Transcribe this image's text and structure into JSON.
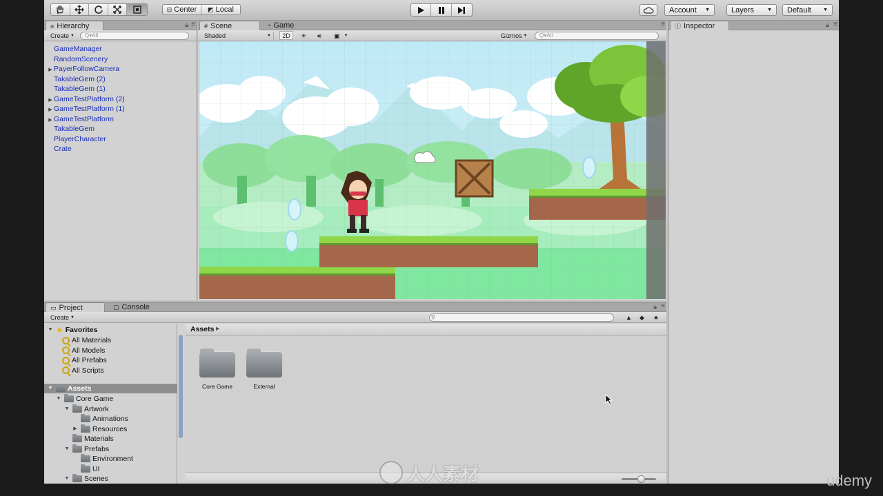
{
  "toolbar": {
    "tools": [
      "hand-tool",
      "move-tool",
      "rotate-tool",
      "scale-tool",
      "rect-tool"
    ],
    "pivot": "Center",
    "space": "Local",
    "account": "Account",
    "layers": "Layers",
    "layout": "Default"
  },
  "hierarchy": {
    "tab": "Hierarchy",
    "create": "Create",
    "search_placeholder": "Q▾All",
    "items": [
      {
        "label": "GameManager",
        "expandable": false
      },
      {
        "label": "RandomScenery",
        "expandable": false
      },
      {
        "label": "PayerFollowCamera",
        "expandable": true
      },
      {
        "label": "TakableGem (2)",
        "expandable": false
      },
      {
        "label": "TakableGem (1)",
        "expandable": false
      },
      {
        "label": "GameTestPlatform (2)",
        "expandable": true
      },
      {
        "label": "GameTestPlatform (1)",
        "expandable": true
      },
      {
        "label": "GameTestPlatform",
        "expandable": true
      },
      {
        "label": "TakableGem",
        "expandable": false
      },
      {
        "label": "PlayerCharacter",
        "expandable": false
      },
      {
        "label": "Crate",
        "expandable": false
      }
    ]
  },
  "scene": {
    "tab_scene": "Scene",
    "tab_game": "Game",
    "shading": "Shaded",
    "mode_2d": "2D",
    "gizmos": "Gizmos",
    "search_placeholder": "Q▾All"
  },
  "inspector": {
    "tab": "Inspector"
  },
  "project": {
    "tab_project": "Project",
    "tab_console": "Console",
    "create": "Create",
    "favorites_label": "Favorites",
    "favorites": [
      "All Materials",
      "All Models",
      "All Prefabs",
      "All Scripts"
    ],
    "assets_label": "Assets",
    "tree": [
      {
        "label": "Core Game",
        "level": 1,
        "arrow": "▼"
      },
      {
        "label": "Artwork",
        "level": 2,
        "arrow": "▼"
      },
      {
        "label": "Animations",
        "level": 3,
        "arrow": ""
      },
      {
        "label": "Resources",
        "level": 3,
        "arrow": "▶"
      },
      {
        "label": "Materials",
        "level": 2,
        "arrow": ""
      },
      {
        "label": "Prefabs",
        "level": 2,
        "arrow": "▼"
      },
      {
        "label": "Environment",
        "level": 3,
        "arrow": ""
      },
      {
        "label": "UI",
        "level": 3,
        "arrow": ""
      },
      {
        "label": "Scenes",
        "level": 2,
        "arrow": "▼"
      }
    ],
    "breadcrumb": "Assets",
    "folders": [
      "Core Game",
      "External"
    ]
  },
  "watermark": {
    "text": "人人素材",
    "brand": "udemy"
  },
  "colors": {
    "hierarchy_text": "#1a2dba",
    "selected_row": "#8e8e8e",
    "sky": "#cdeef9",
    "grass": "#8fde5e",
    "dirt": "#a5674a"
  }
}
